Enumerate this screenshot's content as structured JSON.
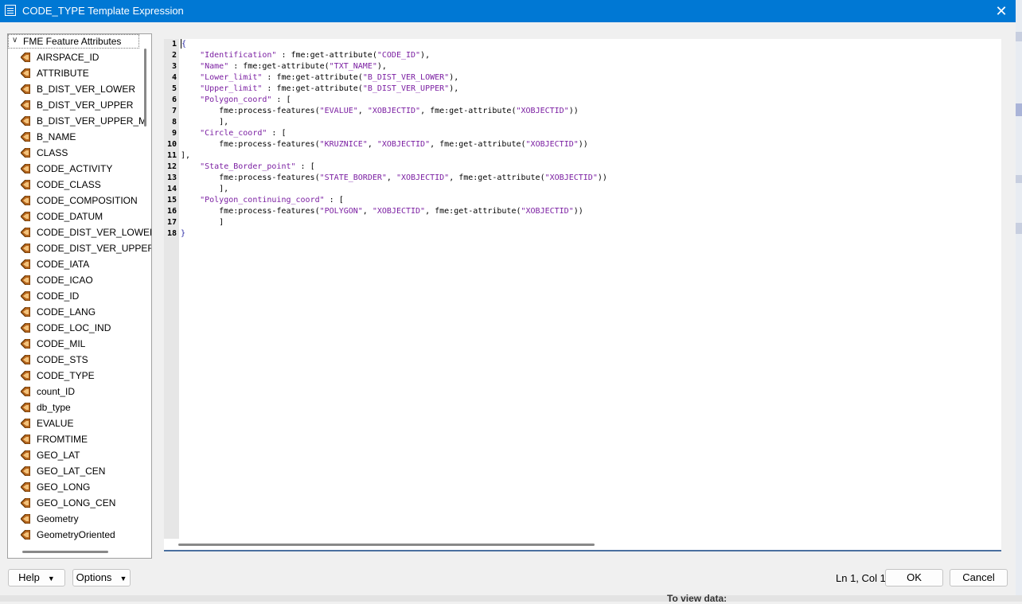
{
  "window": {
    "title": "CODE_TYPE Template Expression",
    "close_label": "✕"
  },
  "tree": {
    "root_label": "FME Feature Attributes",
    "items": [
      "AIRSPACE_ID",
      "ATTRIBUTE",
      "B_DIST_VER_LOWER",
      "B_DIST_VER_UPPER",
      "B_DIST_VER_UPPER_M",
      "B_NAME",
      "CLASS",
      "CODE_ACTIVITY",
      "CODE_CLASS",
      "CODE_COMPOSITION",
      "CODE_DATUM",
      "CODE_DIST_VER_LOWER",
      "CODE_DIST_VER_UPPER",
      "CODE_IATA",
      "CODE_ICAO",
      "CODE_ID",
      "CODE_LANG",
      "CODE_LOC_IND",
      "CODE_MIL",
      "CODE_STS",
      "CODE_TYPE",
      "count_ID",
      "db_type",
      "EVALUE",
      "FROMTIME",
      "GEO_LAT",
      "GEO_LAT_CEN",
      "GEO_LONG",
      "GEO_LONG_CEN",
      "Geometry",
      "GeometryOriented"
    ]
  },
  "editor": {
    "line_numbers": [
      "1",
      "2",
      "3",
      "4",
      "5",
      "6",
      "7",
      "8",
      "9",
      "10",
      "11",
      "12",
      "13",
      "14",
      "15",
      "16",
      "17",
      "18"
    ],
    "lines": [
      "{",
      "    \"Identification\" : fme:get-attribute(\"CODE_ID\"),",
      "    \"Name\" : fme:get-attribute(\"TXT_NAME\"),",
      "    \"Lower_limit\" : fme:get-attribute(\"B_DIST_VER_LOWER\"),",
      "    \"Upper_limit\" : fme:get-attribute(\"B_DIST_VER_UPPER\"),",
      "    \"Polygon_coord\" : [",
      "        fme:process-features(\"EVALUE\", \"XOBJECTID\", fme:get-attribute(\"XOBJECTID\"))",
      "        ],",
      "    \"Circle_coord\" : [",
      "        fme:process-features(\"KRUZNICE\", \"XOBJECTID\", fme:get-attribute(\"XOBJECTID\"))",
      "],",
      "    \"State_Border_point\" : [",
      "        fme:process-features(\"STATE_BORDER\", \"XOBJECTID\", fme:get-attribute(\"XOBJECTID\"))",
      "        ],",
      "    \"Polygon_continuing_coord\" : [",
      "        fme:process-features(\"POLYGON\", \"XOBJECTID\", fme:get-attribute(\"XOBJECTID\"))",
      "        ]",
      "}"
    ]
  },
  "footer": {
    "help_label": "Help",
    "options_label": "Options",
    "status": "Ln 1, Col 1",
    "ok_label": "OK",
    "cancel_label": "Cancel"
  },
  "background": {
    "peek_text": "To view data:"
  },
  "colors": {
    "titlebar": "#0078d4",
    "string": "#7b1fa2",
    "attr_icon": "#b5651d"
  }
}
